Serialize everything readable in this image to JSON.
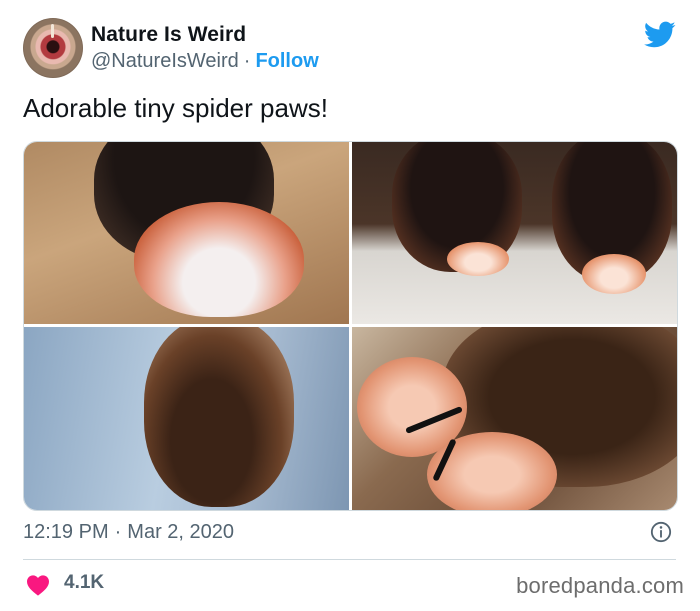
{
  "author": {
    "display_name": "Nature Is Weird",
    "handle": "@NatureIsWeird",
    "separator": "·",
    "follow_label": "Follow"
  },
  "tweet": {
    "text": "Adorable tiny spider paws!",
    "time": "12:19 PM",
    "separator": "·",
    "date": "Mar 2, 2020"
  },
  "media": {
    "image_count": 4
  },
  "engagement": {
    "likes": "4.1K"
  },
  "watermark": "boredpanda.com",
  "icons": {
    "brand": "twitter-bird-icon",
    "info": "info-icon",
    "like": "heart-icon"
  },
  "colors": {
    "accent": "#1d9bf0",
    "like": "#f91880",
    "secondary_text": "#536471",
    "divider": "#cfd9de"
  }
}
